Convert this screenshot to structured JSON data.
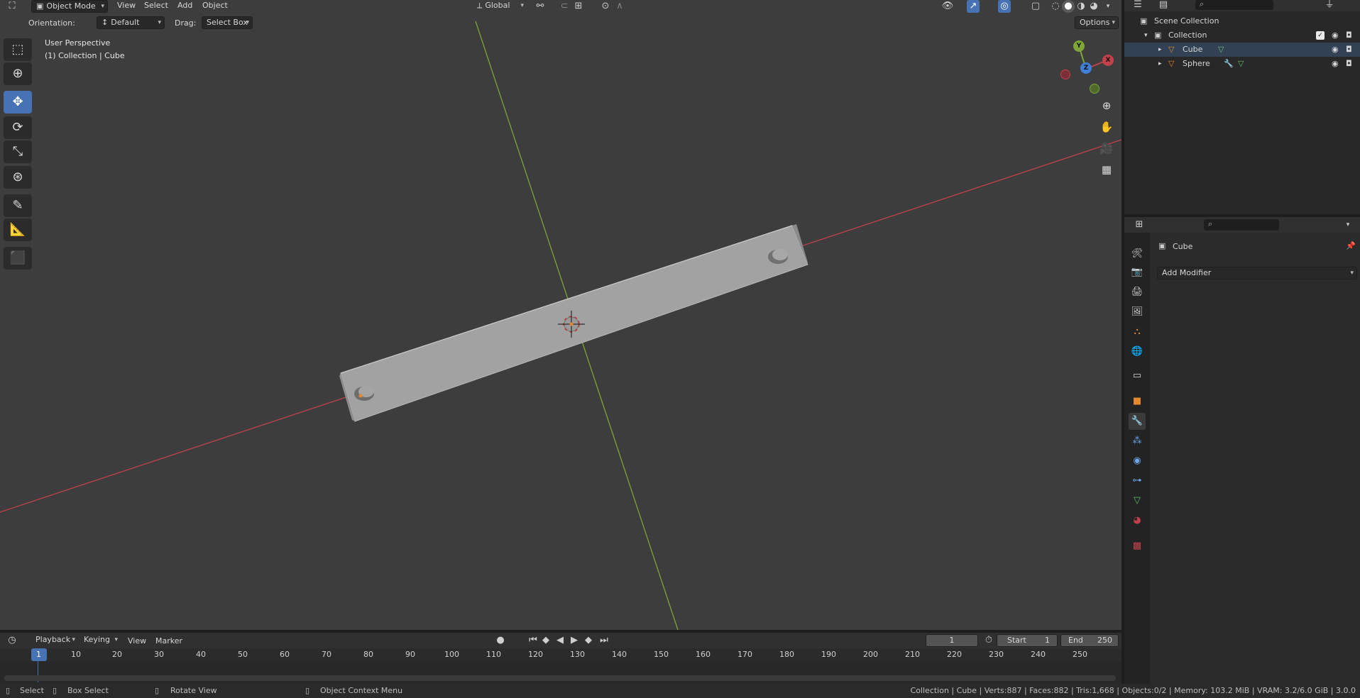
{
  "viewport": {
    "mode_label": "Object Mode",
    "menus": [
      "View",
      "Select",
      "Add",
      "Object"
    ],
    "transform_orientation": "Global",
    "orientation_label": "Orientation:",
    "orientation_value": "Default",
    "drag_label": "Drag:",
    "drag_value": "Select Box",
    "options_label": "Options",
    "overlay_line1": "User Perspective",
    "overlay_line2": "(1) Collection | Cube",
    "gizmo_axes": {
      "x": "X",
      "y": "Y",
      "z": "Z"
    },
    "colors": {
      "x_axis": "#c2414b",
      "y_axis": "#7da538",
      "background": "#3d3d3d",
      "object": "#a0a0a0"
    }
  },
  "toolbar": {
    "tools": [
      {
        "name": "select-box",
        "icon": "select-box-icon",
        "active": false
      },
      {
        "name": "cursor",
        "icon": "cursor-icon",
        "active": false
      },
      {
        "name": "move",
        "icon": "move-icon",
        "active": true
      },
      {
        "name": "rotate",
        "icon": "rotate-icon",
        "active": false
      },
      {
        "name": "scale",
        "icon": "scale-icon",
        "active": false
      },
      {
        "name": "transform",
        "icon": "transform-icon",
        "active": false
      },
      {
        "name": "annotate",
        "icon": "annotate-icon",
        "active": false
      },
      {
        "name": "measure",
        "icon": "measure-icon",
        "active": false
      },
      {
        "name": "add-cube",
        "icon": "add-cube-icon",
        "active": false
      }
    ]
  },
  "outliner": {
    "scene_collection": "Scene Collection",
    "collection": "Collection",
    "items": [
      {
        "label": "Cube"
      },
      {
        "label": "Sphere"
      }
    ]
  },
  "properties": {
    "object_name": "Cube",
    "add_modifier_label": "Add Modifier"
  },
  "timeline": {
    "menus": [
      "Playback",
      "Keying",
      "View",
      "Marker"
    ],
    "current_frame": "1",
    "start_label": "Start",
    "start_value": "1",
    "end_label": "End",
    "end_value": "250",
    "ticks": [
      "1",
      "10",
      "20",
      "30",
      "40",
      "50",
      "60",
      "70",
      "80",
      "90",
      "100",
      "110",
      "120",
      "130",
      "140",
      "150",
      "160",
      "170",
      "180",
      "190",
      "200",
      "210",
      "220",
      "230",
      "240",
      "250"
    ]
  },
  "statusbar": {
    "select": "Select",
    "box_select": "Box Select",
    "rotate_view": "Rotate View",
    "context_menu": "Object Context Menu",
    "stats": "Collection | Cube | Verts:887 | Faces:882 | Tris:1,668 | Objects:0/2 | Memory: 103.2 MiB | VRAM: 3.2/6.0 GiB | 3.0.0"
  }
}
